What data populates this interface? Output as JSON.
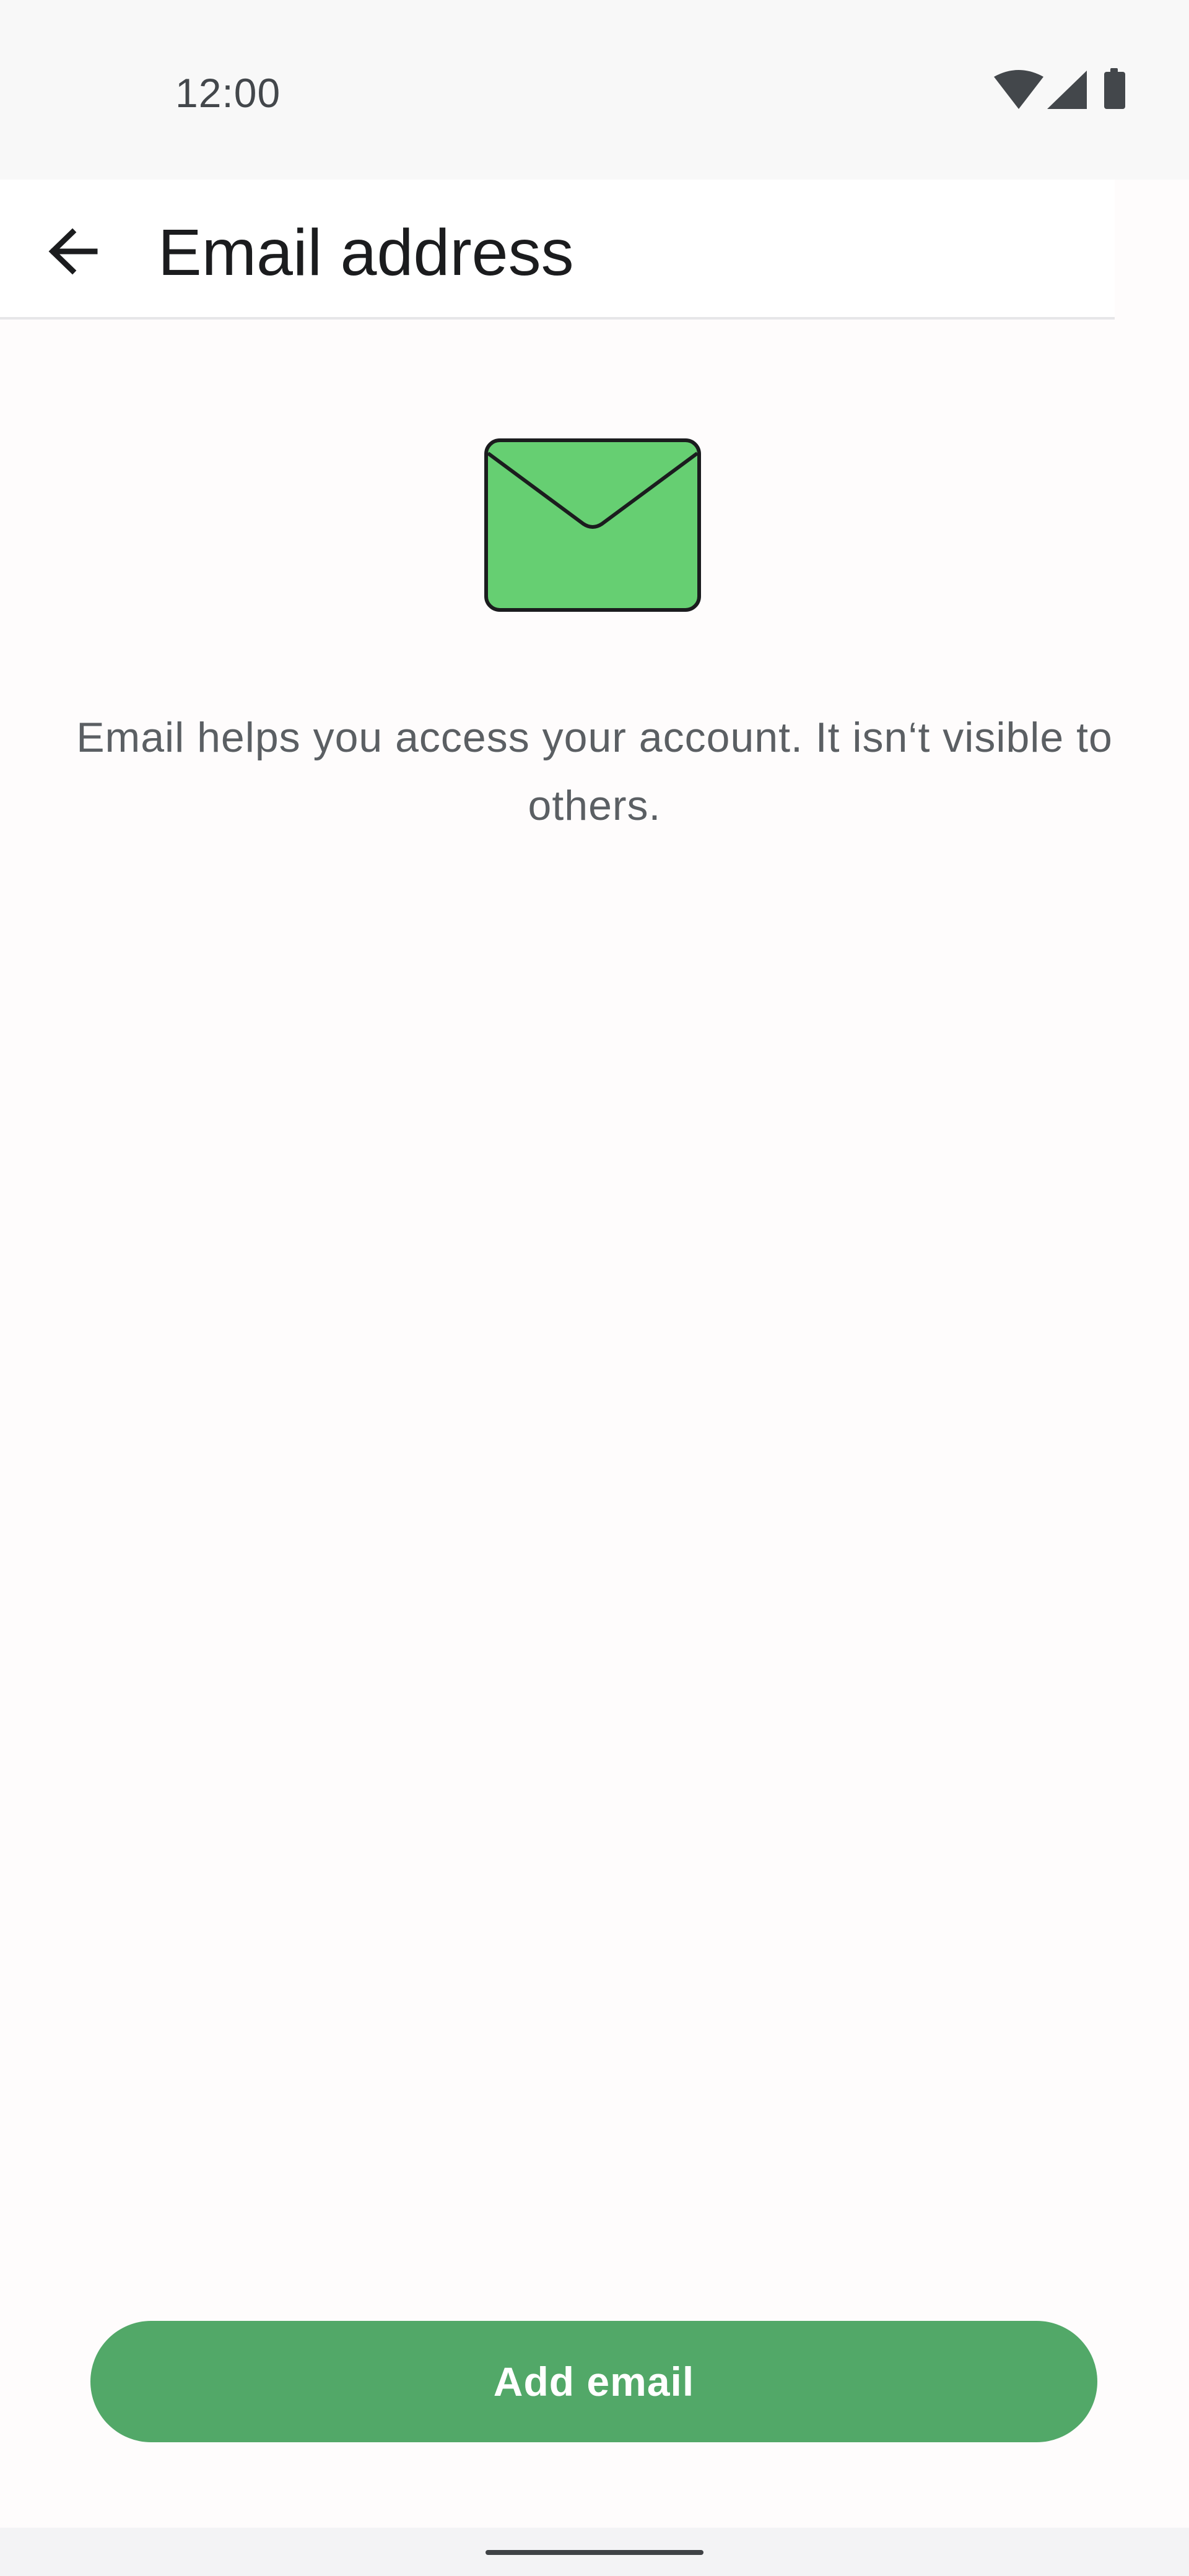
{
  "status_bar": {
    "time": "12:00",
    "icons": [
      "wifi-icon",
      "signal-icon",
      "battery-icon"
    ]
  },
  "app_bar": {
    "back_icon": "arrow-left-icon",
    "title": "Email address"
  },
  "content": {
    "illustration_icon": "envelope-icon",
    "description": "Email helps you access your account. It isn‘t visible to others."
  },
  "actions": {
    "add_email_label": "Add email"
  },
  "colors": {
    "primary_button": "#52a868",
    "envelope_fill": "#66cf72",
    "text_primary": "#1b1c1e",
    "text_secondary": "#5b5f63"
  }
}
